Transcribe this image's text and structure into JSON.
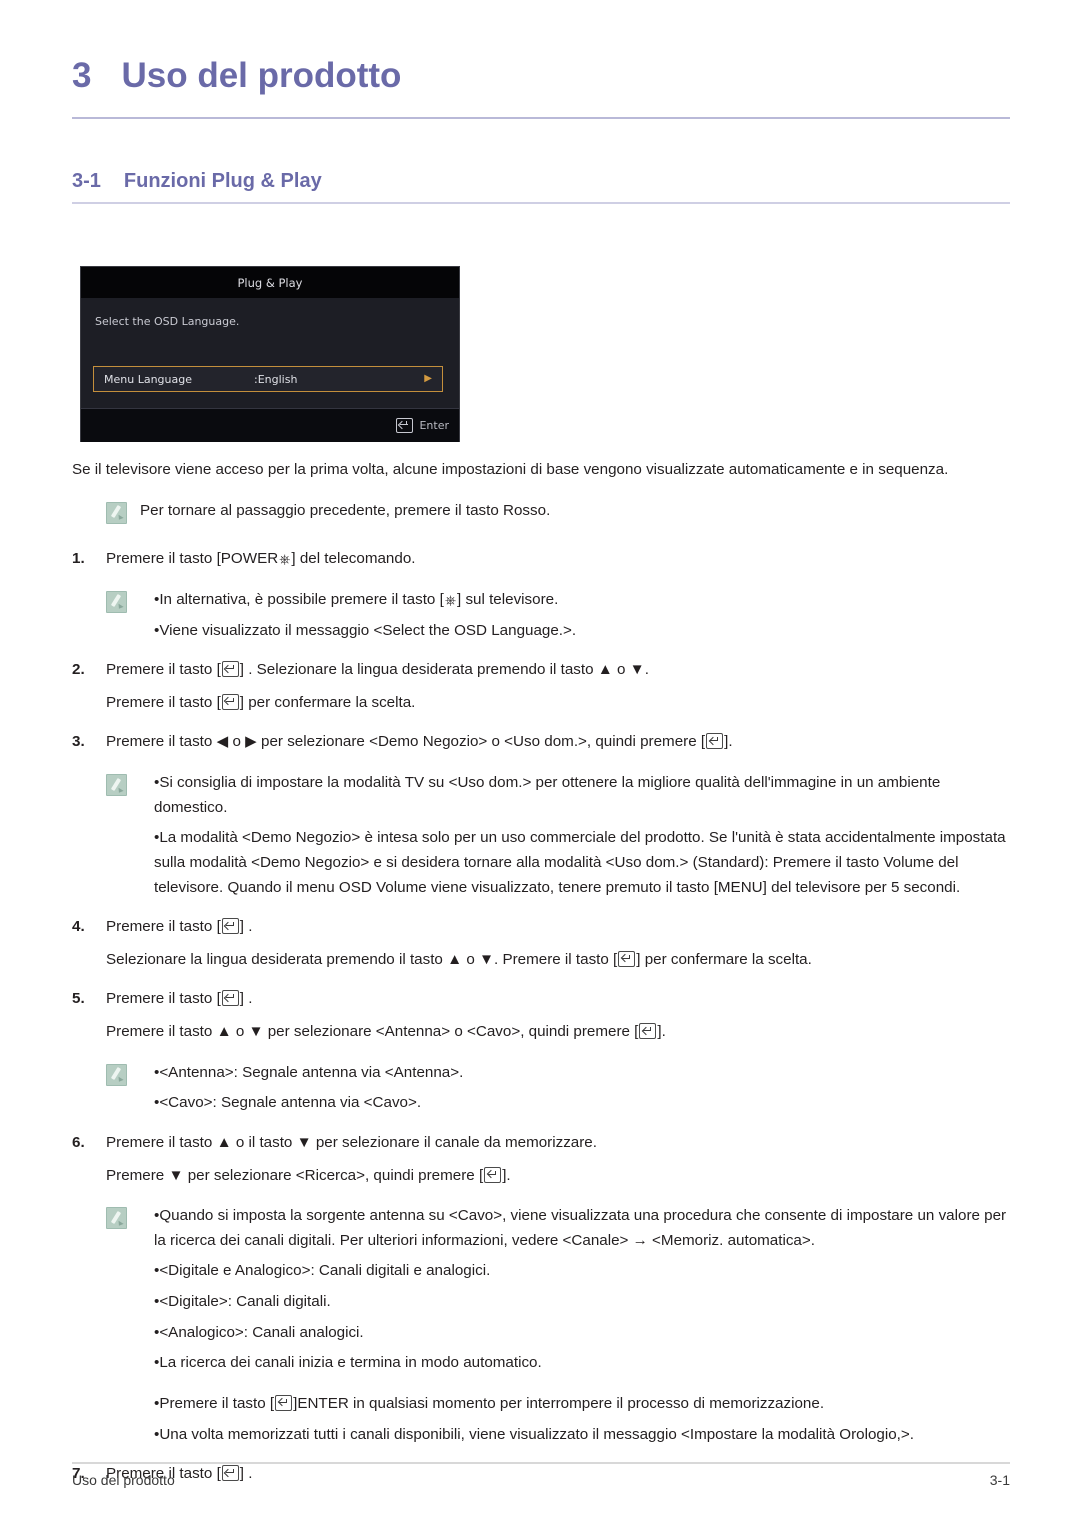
{
  "chapter": {
    "number": "3",
    "title": "Uso del prodotto"
  },
  "section": {
    "number": "3-1",
    "title": "Funzioni Plug & Play"
  },
  "osd": {
    "title": "Plug & Play",
    "prompt": "Select the OSD Language.",
    "row_label": "Menu Language",
    "row_value": ":English",
    "row_arrow": "▶",
    "footer_label": "Enter",
    "border_color": "#c48f3c",
    "arrow_color": "#d39a41"
  },
  "intro": "Se il televisore viene acceso per la prima volta, alcune impostazioni di base vengono visualizzate automaticamente e in sequenza.",
  "note_intro": "Per tornare al passaggio precedente, premere il tasto Rosso.",
  "steps": {
    "s1": {
      "number": "1.",
      "text_before": "Premere il tasto [POWER",
      "text_after": "] del telecomando.",
      "note_1a_before": "•In alternativa, è possibile premere il tasto [",
      "note_1a_after": "] sul televisore.",
      "note_1b": "•Viene visualizzato il messaggio <Select the OSD Language.>."
    },
    "s2": {
      "number": "2.",
      "line1_a": "Premere il tasto [",
      "line1_b": "] . Selezionare la lingua desiderata premendo il tasto ▲ o ▼.",
      "line2_a": "Premere il tasto [",
      "line2_b": "] per confermare la scelta."
    },
    "s3": {
      "number": "3.",
      "line1_a": "Premere il tasto ◀ o ▶ per selezionare <Demo Negozio> o <Uso dom.>, quindi premere [",
      "line1_b": "].",
      "note_3a": "•Si consiglia di impostare la modalità TV su <Uso dom.> per ottenere la migliore qualità dell'immagine in un ambiente domestico.",
      "note_3b": "•La modalità <Demo Negozio> è intesa solo per un uso commerciale del prodotto. Se l'unità è stata accidentalmente impostata sulla modalità <Demo Negozio> e si desidera tornare alla modalità <Uso dom.> (Standard): Premere il tasto Volume del televisore. Quando il menu OSD Volume viene visualizzato, tenere premuto il tasto [MENU] del televisore per 5 secondi."
    },
    "s4": {
      "number": "4.",
      "line1_a": "Premere il tasto [",
      "line1_b": "] .",
      "line2_a": "Selezionare la lingua desiderata premendo il tasto ▲ o ▼. Premere il tasto [",
      "line2_b": "] per confermare la scelta."
    },
    "s5": {
      "number": "5.",
      "line1_a": "Premere il tasto [",
      "line1_b": "] .",
      "line2_a": "Premere il tasto ▲ o ▼ per selezionare <Antenna> o <Cavo>, quindi premere [",
      "line2_b": "].",
      "note_5a": "•<Antenna>: Segnale antenna via <Antenna>.",
      "note_5b": "•<Cavo>: Segnale antenna via <Cavo>."
    },
    "s6": {
      "number": "6.",
      "line1": "Premere il tasto ▲ o il tasto ▼ per selezionare il canale da memorizzare.",
      "line2_a": "Premere ▼ per selezionare <Ricerca>, quindi premere [",
      "line2_b": "].",
      "note_6a": "•Quando si imposta la sorgente antenna su <Cavo>, viene visualizzata una procedura che consente di impostare un valore per la ricerca dei canali digitali. Per ulteriori informazioni, vedere <Canale> → <Memoriz. automatica>.",
      "note_6b": "•<Digitale e Analogico>: Canali digitali e analogici.",
      "note_6c": "•<Digitale>: Canali digitali.",
      "note_6d": "•<Analogico>: Canali analogici.",
      "note_6e": "•La ricerca dei canali inizia e termina in modo automatico.",
      "note_6f_a": "•Premere il tasto [",
      "note_6f_b": "]ENTER in qualsiasi momento per interrompere il processo di memorizzazione.",
      "note_6g": "•Una volta memorizzati tutti i canali disponibili, viene visualizzato il messaggio <Impostare la modalità Orologio,>."
    },
    "s7": {
      "number": "7.",
      "line1_a": "Premere il tasto [",
      "line1_b": "] ."
    }
  },
  "footer": {
    "left": "Uso del prodotto",
    "right": "3-1"
  }
}
